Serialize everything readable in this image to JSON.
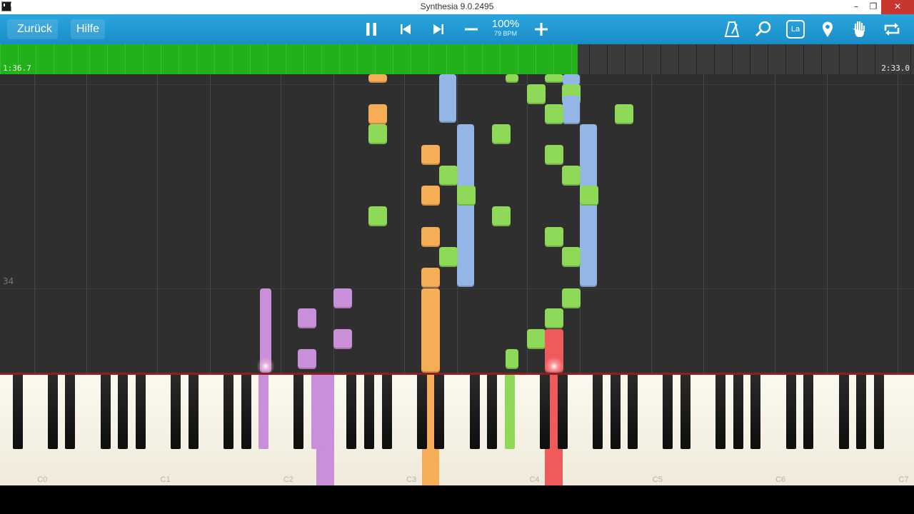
{
  "window": {
    "title": "Synthesia 9.0.2495"
  },
  "toolbar": {
    "back_label": "Zurück",
    "help_label": "Hilfe",
    "tempo_percent": "100%",
    "tempo_bpm": "79 BPM",
    "icons": [
      "pause-icon",
      "skip-back-icon",
      "skip-forward-icon",
      "minus-icon",
      "plus-icon",
      "metronome-icon",
      "zoom-icon",
      "note-labels-icon",
      "bookmark-icon",
      "hand-icon",
      "loop-icon"
    ],
    "note_labels_badge": "La"
  },
  "progress": {
    "elapsed": "1:36.7",
    "total": "2:33.0",
    "fraction": 0.632
  },
  "falling_notes": {
    "measure_number": "34"
  },
  "keyboard": {
    "octave_labels": [
      "C0",
      "C1",
      "C2",
      "C3",
      "C4",
      "C5",
      "C6",
      "C7"
    ]
  },
  "colors": {
    "accent": "#1e96d1",
    "progress": "#22b11a",
    "note_green": "#8ed957",
    "note_orange": "#f5ae55",
    "note_blue": "#93b6e6",
    "note_purple": "#c98fd8",
    "note_red": "#ef5b5b"
  }
}
